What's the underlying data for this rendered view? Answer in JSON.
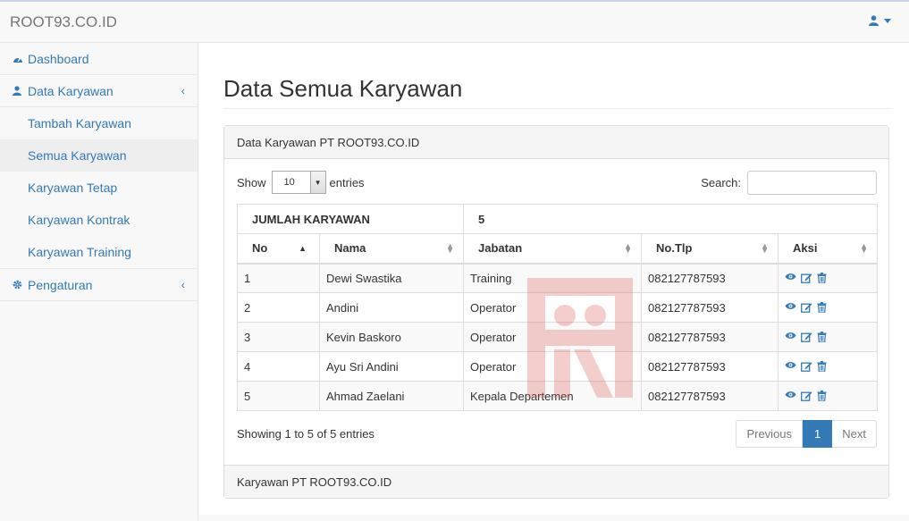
{
  "brand": "ROOT93.CO.ID",
  "sidebar": {
    "dashboard": "Dashboard",
    "data_karyawan": "Data Karyawan",
    "sub_items": [
      "Tambah Karyawan",
      "Semua Karyawan",
      "Karyawan Tetap",
      "Karyawan Kontrak",
      "Karyawan Training"
    ],
    "pengaturan": "Pengaturan"
  },
  "page": {
    "title": "Data Semua Karyawan",
    "panel_heading": "Data Karyawan PT ROOT93.CO.ID",
    "panel_footer": "Karyawan PT ROOT93.CO.ID"
  },
  "datatable": {
    "show_label": "Show",
    "entries_value": "10",
    "entries_label": "entries",
    "search_label": "Search:",
    "summary_label": "JUMLAH KARYAWAN",
    "summary_value": "5",
    "columns": [
      "No",
      "Nama",
      "Jabatan",
      "No.Tlp",
      "Aksi"
    ],
    "rows": [
      {
        "no": "1",
        "nama": "Dewi Swastika",
        "jabatan": "Training",
        "tlp": "082127787593"
      },
      {
        "no": "2",
        "nama": "Andini",
        "jabatan": "Operator",
        "tlp": "082127787593"
      },
      {
        "no": "3",
        "nama": "Kevin Baskoro",
        "jabatan": "Operator",
        "tlp": "082127787593"
      },
      {
        "no": "4",
        "nama": "Ayu Sri Andini",
        "jabatan": "Operator",
        "tlp": "082127787593"
      },
      {
        "no": "5",
        "nama": "Ahmad Zaelani",
        "jabatan": "Kepala Departemen",
        "tlp": "082127787593"
      }
    ],
    "info": "Showing 1 to 5 of 5 entries",
    "pager": {
      "previous": "Previous",
      "current": "1",
      "next": "Next"
    }
  },
  "colors": {
    "accent": "#337ab7",
    "watermark": "#d9534f"
  },
  "icons": [
    "user-icon",
    "caret-down-icon",
    "dashboard-icon",
    "user-icon",
    "chevron-left-icon",
    "gear-icon",
    "sort-icon",
    "eye-icon",
    "edit-icon",
    "trash-icon"
  ]
}
